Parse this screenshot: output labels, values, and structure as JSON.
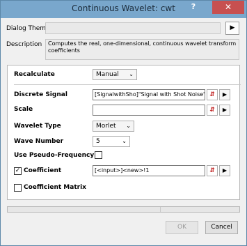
{
  "window": {
    "title": "Continuous Wavelet: cwt",
    "help_glyph": "?",
    "close_glyph": "✕"
  },
  "dialog_theme": {
    "label": "Dialog Theme",
    "value": "",
    "arrow_glyph": "▶"
  },
  "description": {
    "label": "Description",
    "text": "Computes the real, one-dimensional, continuous wavelet transform coefficients"
  },
  "fields": {
    "recalculate": {
      "label": "Recalculate",
      "value": "Manual"
    },
    "discrete_signal": {
      "label": "Discrete Signal",
      "value": "[SignalwithSho]\"Signal with Shot Noise\"!E"
    },
    "scale": {
      "label": "Scale",
      "value": ""
    },
    "wavelet_type": {
      "label": "Wavelet Type",
      "value": "Morlet"
    },
    "wave_number": {
      "label": "Wave Number",
      "value": "5"
    },
    "use_pseudo_frequency": {
      "label": "Use Pseudo-Frequency",
      "checked": false
    },
    "coefficient": {
      "label": "Coefficient",
      "checked": true,
      "value": "[<input>]<new>!1"
    },
    "coefficient_matrix": {
      "label": "Coefficient Matrix",
      "checked": false
    }
  },
  "glyphs": {
    "combo_arrow": "⌄",
    "picker": "⇵",
    "play": "▶",
    "check": "✓"
  },
  "buttons": {
    "ok": "OK",
    "cancel": "Cancel"
  }
}
